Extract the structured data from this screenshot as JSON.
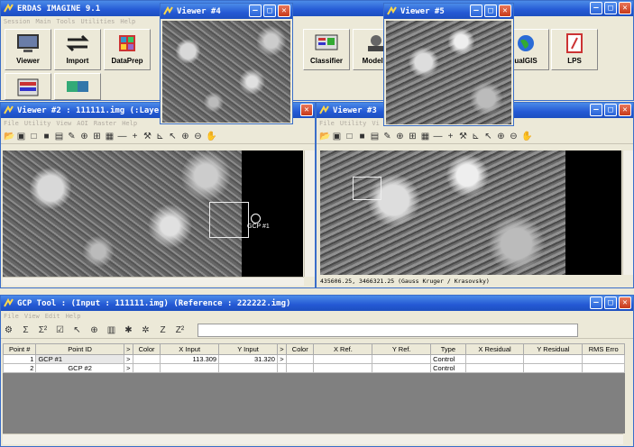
{
  "main": {
    "title": "ERDAS IMAGINE 9.1",
    "menu": [
      "Session",
      "Main",
      "Tools",
      "Utilities",
      "Help"
    ],
    "buttons": {
      "viewer": "Viewer",
      "import": "Import",
      "dataprep": "DataPrep",
      "classifier": "Classifier",
      "modeler": "Modeler",
      "vgis": "ualGIS",
      "lps": "LPS"
    }
  },
  "viewer2": {
    "title": "Viewer #2 : 111111.img (:Laye",
    "menu": [
      "File",
      "Utility",
      "View",
      "AOI",
      "Raster",
      "Help"
    ],
    "gcp_label": "GCP #1"
  },
  "viewer3": {
    "title": "Viewer #3",
    "menu": [
      "File",
      "Utility",
      "Vi"
    ],
    "status": "435606.25, 3466321.25  (Gauss Kruger / Krasovsky)"
  },
  "viewer4": {
    "title": "Viewer #4"
  },
  "viewer5": {
    "title": "Viewer #5"
  },
  "gcp": {
    "title": "GCP Tool : (Input : 111111.img) (Reference : 222222.img)",
    "menu": [
      "File",
      "View",
      "Edit",
      "Help"
    ],
    "columns": [
      "Point #",
      "Point ID",
      ">",
      "Color",
      "X Input",
      "Y Input",
      ">",
      "Color",
      "X Ref.",
      "Y Ref.",
      "Type",
      "X Residual",
      "Y Residual",
      "RMS Erro"
    ],
    "rows": [
      {
        "num": "1",
        "id": "GCP #1",
        "xin": "113.309",
        "yin": "31.320",
        "type": "Control"
      },
      {
        "num": "2",
        "id": "GCP #2",
        "xin": "",
        "yin": "",
        "type": "Control"
      }
    ]
  },
  "colors": {
    "titlebar": "#2459d4",
    "window_bg": "#ece9d8",
    "close": "#c7391a"
  }
}
